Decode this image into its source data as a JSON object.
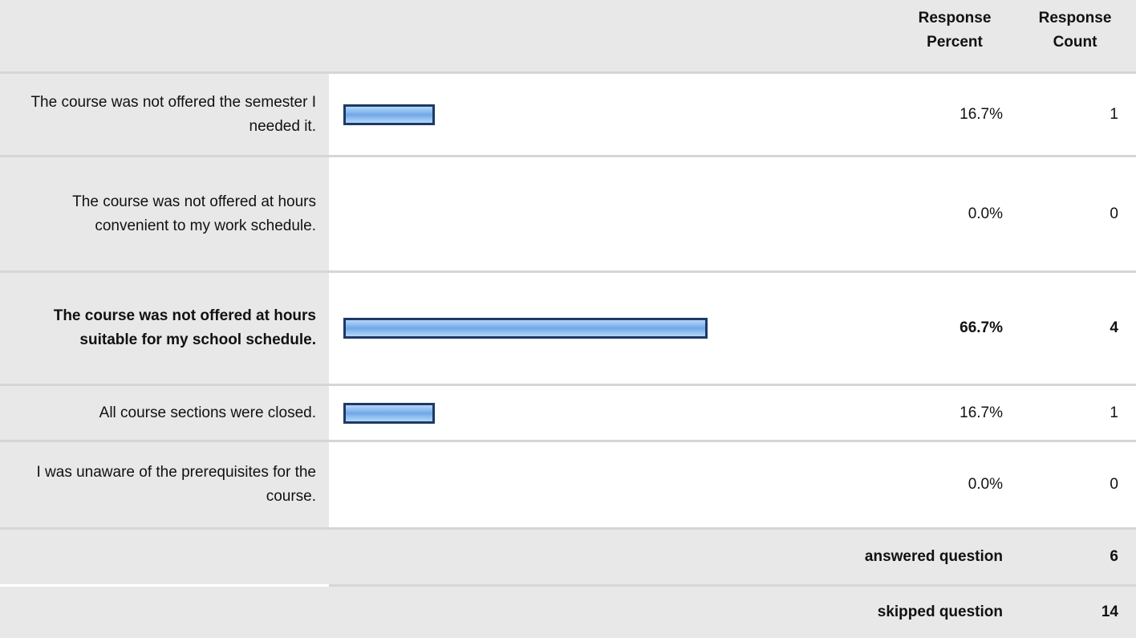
{
  "header": {
    "percent_line1": "Response",
    "percent_line2": "Percent",
    "count_line1": "Response",
    "count_line2": "Count"
  },
  "chart_data": {
    "type": "bar",
    "orientation": "horizontal",
    "categories": [
      "The course was not offered the semester I needed it.",
      "The course was not offered at hours convenient to my work schedule.",
      "The course was not offered at hours suitable for my school schedule.",
      "All course sections were closed.",
      "I was unaware of the prerequisites for the course."
    ],
    "values": [
      16.7,
      0.0,
      66.7,
      16.7,
      0.0
    ],
    "percent_labels": [
      "16.7%",
      "0.0%",
      "66.7%",
      "16.7%",
      "0.0%"
    ],
    "counts": [
      "1",
      "0",
      "4",
      "1",
      "0"
    ],
    "highlighted_index": 2,
    "bar_color": "#8cbcf0",
    "bar_border_color": "#1d3a66",
    "xlim": [
      0,
      100
    ]
  },
  "summary": {
    "answered_label": "answered question",
    "answered_value": "6",
    "skipped_label": "skipped question",
    "skipped_value": "14"
  }
}
